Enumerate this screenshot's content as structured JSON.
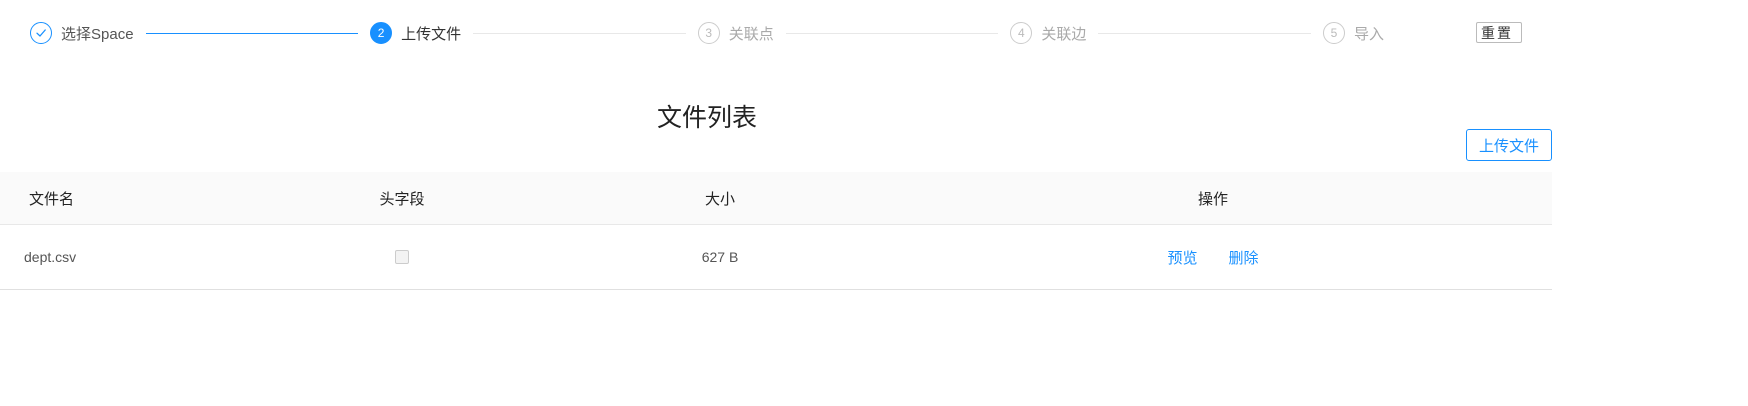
{
  "steps": {
    "items": [
      {
        "number": "1",
        "title": "选择Space",
        "status": "finished"
      },
      {
        "number": "2",
        "title": "上传文件",
        "status": "active"
      },
      {
        "number": "3",
        "title": "关联点",
        "status": "wait"
      },
      {
        "number": "4",
        "title": "关联边",
        "status": "wait"
      },
      {
        "number": "5",
        "title": "导入",
        "status": "wait"
      }
    ],
    "reset_label": "重置"
  },
  "file_list": {
    "title": "文件列表",
    "upload_button_label": "上传文件",
    "columns": {
      "name": "文件名",
      "header": "头字段",
      "size": "大小",
      "actions": "操作"
    },
    "rows": [
      {
        "name": "dept.csv",
        "header_checked": false,
        "size": "627 B",
        "preview_label": "预览",
        "delete_label": "删除"
      }
    ]
  },
  "colors": {
    "primary": "#1890ff",
    "border": "#e8e8e8",
    "table_header_bg": "#fafafa"
  },
  "icons": {
    "finished_step": "check-icon"
  }
}
